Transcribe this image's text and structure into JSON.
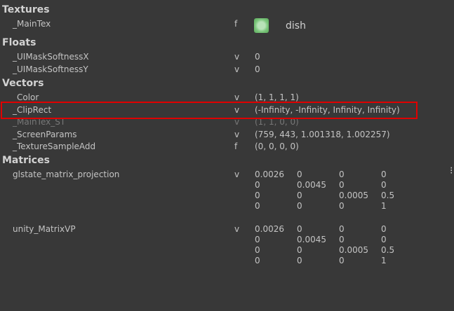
{
  "sections": {
    "textures": "Textures",
    "floats": "Floats",
    "vectors": "Vectors",
    "matrices": "Matrices"
  },
  "textures": [
    {
      "name": "_MainTex",
      "type": "f",
      "texture_name": "dish"
    }
  ],
  "floats": [
    {
      "name": "_UIMaskSoftnessX",
      "type": "v",
      "value": "0"
    },
    {
      "name": "_UIMaskSoftnessY",
      "type": "v",
      "value": "0"
    }
  ],
  "vectors": [
    {
      "name": "_Color",
      "type": "v",
      "value": "(1, 1, 1, 1)"
    },
    {
      "name": "_ClipRect",
      "type": "v",
      "value": "(-Infinity, -Infinity, Infinity, Infinity)"
    },
    {
      "name": "_MainTex_ST",
      "type": "v",
      "value": "(1, 1, 0, 0)"
    },
    {
      "name": "_ScreenParams",
      "type": "v",
      "value": "(759, 443, 1.001318, 1.002257)"
    },
    {
      "name": "_TextureSampleAdd",
      "type": "f",
      "value": "(0, 0, 0, 0)"
    }
  ],
  "matrices": [
    {
      "name": "glstate_matrix_projection",
      "type": "v",
      "rows": [
        [
          "0.0026",
          "0",
          "0",
          "0"
        ],
        [
          "0",
          "0.0045",
          "0",
          "0"
        ],
        [
          "0",
          "0",
          "0.0005",
          "0.5"
        ],
        [
          "0",
          "0",
          "0",
          "1"
        ]
      ]
    },
    {
      "name": "unity_MatrixVP",
      "type": "v",
      "rows": [
        [
          "0.0026",
          "0",
          "0",
          "0"
        ],
        [
          "0",
          "0.0045",
          "0",
          "0"
        ],
        [
          "0",
          "0",
          "0.0005",
          "0.5"
        ],
        [
          "0",
          "0",
          "0",
          "1"
        ]
      ]
    }
  ],
  "colors": {
    "background": "#383838",
    "text": "#c4c4c4",
    "highlight_border": "#e00000"
  }
}
